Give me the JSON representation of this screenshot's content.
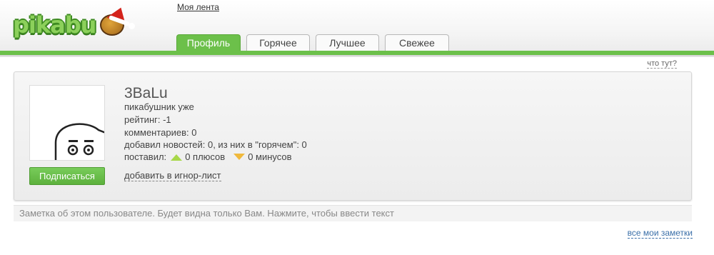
{
  "logo": {
    "text": "pikabu"
  },
  "header": {
    "feed_link": "Моя лента"
  },
  "tabs": [
    {
      "label": "Профиль",
      "active": true
    },
    {
      "label": "Горячее",
      "active": false
    },
    {
      "label": "Лучшее",
      "active": false
    },
    {
      "label": "Свежее",
      "active": false
    }
  ],
  "help_link": "что тут?",
  "profile": {
    "username": "3BaLu",
    "rank": "пикабушник уже",
    "rating": "рейтинг: -1",
    "comments": "комментариев: 0",
    "news": "добавил новостей: 0, из них в \"горячем\": 0",
    "votes_label": "поставил:",
    "plus": "0 плюсов",
    "minus": "0 минусов",
    "subscribe_label": "Подписаться",
    "ignore_label": "добавить в игнор-лист"
  },
  "note": {
    "placeholder": "Заметка об этом пользователе. Будет видна только Вам. Нажмите, чтобы ввести текст"
  },
  "my_notes_link": "все мои заметки",
  "colors": {
    "accent_green": "#6cc04a",
    "link_blue": "#3a6fa8",
    "plus": "#a8d84a",
    "minus": "#f0b93c"
  }
}
